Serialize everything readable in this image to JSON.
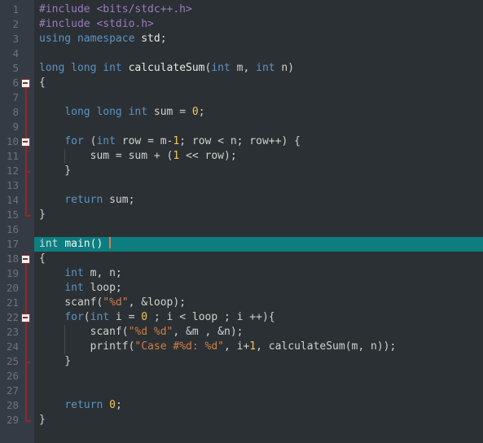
{
  "editor": {
    "language": "cpp",
    "total_lines": 29,
    "current_line": 17,
    "caret_line": 17,
    "colors": {
      "background": "#2b3034",
      "gutter_background": "#353b45",
      "line_number": "#697481",
      "current_line_highlight": "#0d7d80",
      "fold_marker": "#8e2a2a",
      "caret": "#d97d3f",
      "keyword": "#5d93c4",
      "preprocessor": "#9b7bc0",
      "string": "#ce7f47",
      "number": "#f2c75c",
      "identifier": "#cfd2cd",
      "function": "#e6e8e3",
      "indent_guide": "#4b525b"
    },
    "line_numbers": [
      1,
      2,
      3,
      4,
      5,
      6,
      7,
      8,
      9,
      10,
      11,
      12,
      13,
      14,
      15,
      16,
      17,
      18,
      19,
      20,
      21,
      22,
      23,
      24,
      25,
      26,
      27,
      28,
      29
    ],
    "fold_markers": [
      {
        "line": 6,
        "state": "expanded",
        "icon": "fold-minus-icon"
      },
      {
        "line": 10,
        "state": "expanded",
        "icon": "fold-minus-icon"
      },
      {
        "line": 18,
        "state": "expanded",
        "icon": "fold-minus-icon"
      },
      {
        "line": 22,
        "state": "expanded",
        "icon": "fold-minus-icon"
      }
    ],
    "lines": [
      {
        "n": 1,
        "tokens": [
          {
            "t": "#include <bits/stdc++.h>",
            "c": "pre"
          }
        ]
      },
      {
        "n": 2,
        "tokens": [
          {
            "t": "#include <stdio.h>",
            "c": "pre"
          }
        ]
      },
      {
        "n": 3,
        "tokens": [
          {
            "t": "using namespace",
            "c": "kw"
          },
          {
            "t": " ",
            "c": "plain"
          },
          {
            "t": "std",
            "c": "fn"
          },
          {
            "t": ";",
            "c": "id"
          }
        ]
      },
      {
        "n": 4,
        "tokens": []
      },
      {
        "n": 5,
        "tokens": [
          {
            "t": "long long int",
            "c": "kw"
          },
          {
            "t": " ",
            "c": "plain"
          },
          {
            "t": "calculateSum",
            "c": "fn"
          },
          {
            "t": "(",
            "c": "id"
          },
          {
            "t": "int",
            "c": "kw"
          },
          {
            "t": " m, ",
            "c": "id"
          },
          {
            "t": "int",
            "c": "kw"
          },
          {
            "t": " n)",
            "c": "id"
          }
        ]
      },
      {
        "n": 6,
        "tokens": [
          {
            "t": "{",
            "c": "id"
          }
        ]
      },
      {
        "n": 7,
        "tokens": []
      },
      {
        "n": 8,
        "tokens": [
          {
            "t": "    ",
            "c": "plain"
          },
          {
            "t": "long long int",
            "c": "kw"
          },
          {
            "t": " sum = ",
            "c": "id"
          },
          {
            "t": "0",
            "c": "num"
          },
          {
            "t": ";",
            "c": "id"
          }
        ]
      },
      {
        "n": 9,
        "tokens": []
      },
      {
        "n": 10,
        "tokens": [
          {
            "t": "    ",
            "c": "plain"
          },
          {
            "t": "for",
            "c": "kw"
          },
          {
            "t": " (",
            "c": "id"
          },
          {
            "t": "int",
            "c": "kw"
          },
          {
            "t": " row = m-",
            "c": "id"
          },
          {
            "t": "1",
            "c": "num"
          },
          {
            "t": "; row < n; row++) {",
            "c": "id"
          }
        ]
      },
      {
        "n": 11,
        "tokens": [
          {
            "t": "        sum = sum + (",
            "c": "id"
          },
          {
            "t": "1",
            "c": "num"
          },
          {
            "t": " << row);",
            "c": "id"
          }
        ]
      },
      {
        "n": 12,
        "tokens": [
          {
            "t": "    }",
            "c": "id"
          }
        ]
      },
      {
        "n": 13,
        "tokens": []
      },
      {
        "n": 14,
        "tokens": [
          {
            "t": "    ",
            "c": "plain"
          },
          {
            "t": "return",
            "c": "kw"
          },
          {
            "t": " sum;",
            "c": "id"
          }
        ]
      },
      {
        "n": 15,
        "tokens": [
          {
            "t": "}",
            "c": "id"
          }
        ]
      },
      {
        "n": 16,
        "tokens": []
      },
      {
        "n": 17,
        "tokens": [
          {
            "t": "int",
            "c": "kw"
          },
          {
            "t": " ",
            "c": "plain"
          },
          {
            "t": "main",
            "c": "fn"
          },
          {
            "t": "() ",
            "c": "id"
          }
        ],
        "caret_after": true
      },
      {
        "n": 18,
        "tokens": [
          {
            "t": "{",
            "c": "id"
          }
        ]
      },
      {
        "n": 19,
        "tokens": [
          {
            "t": "    ",
            "c": "plain"
          },
          {
            "t": "int",
            "c": "kw"
          },
          {
            "t": " m, n;",
            "c": "id"
          }
        ]
      },
      {
        "n": 20,
        "tokens": [
          {
            "t": "    ",
            "c": "plain"
          },
          {
            "t": "int",
            "c": "kw"
          },
          {
            "t": " loop;",
            "c": "id"
          }
        ]
      },
      {
        "n": 21,
        "tokens": [
          {
            "t": "    scanf(",
            "c": "id"
          },
          {
            "t": "\"%d\"",
            "c": "str"
          },
          {
            "t": ", &loop);",
            "c": "id"
          }
        ]
      },
      {
        "n": 22,
        "tokens": [
          {
            "t": "    ",
            "c": "plain"
          },
          {
            "t": "for",
            "c": "kw"
          },
          {
            "t": "(",
            "c": "id"
          },
          {
            "t": "int",
            "c": "kw"
          },
          {
            "t": " i = ",
            "c": "id"
          },
          {
            "t": "0",
            "c": "num"
          },
          {
            "t": " ; i < loop ; i ++){",
            "c": "id"
          }
        ]
      },
      {
        "n": 23,
        "tokens": [
          {
            "t": "        scanf(",
            "c": "id"
          },
          {
            "t": "\"%d %d\"",
            "c": "str"
          },
          {
            "t": ", &m , &n);",
            "c": "id"
          }
        ]
      },
      {
        "n": 24,
        "tokens": [
          {
            "t": "        printf(",
            "c": "id"
          },
          {
            "t": "\"Case #%d: %d\"",
            "c": "str"
          },
          {
            "t": ", i+",
            "c": "id"
          },
          {
            "t": "1",
            "c": "num"
          },
          {
            "t": ", calculateSum(m, n));",
            "c": "id"
          }
        ]
      },
      {
        "n": 25,
        "tokens": [
          {
            "t": "    }",
            "c": "id"
          }
        ]
      },
      {
        "n": 26,
        "tokens": []
      },
      {
        "n": 27,
        "tokens": []
      },
      {
        "n": 28,
        "tokens": [
          {
            "t": "    ",
            "c": "plain"
          },
          {
            "t": "return",
            "c": "kw"
          },
          {
            "t": " ",
            "c": "plain"
          },
          {
            "t": "0",
            "c": "num"
          },
          {
            "t": ";",
            "c": "id"
          }
        ]
      },
      {
        "n": 29,
        "tokens": [
          {
            "t": "}",
            "c": "id"
          }
        ]
      }
    ],
    "indent_guides": [
      {
        "line": 11,
        "col": 1
      },
      {
        "line": 23,
        "col": 1
      },
      {
        "line": 24,
        "col": 1
      }
    ],
    "fold_regions": [
      {
        "start": 6,
        "end": 15,
        "tick_lines": [
          12
        ]
      },
      {
        "start": 18,
        "end": 29,
        "tick_lines": [
          25
        ]
      }
    ]
  }
}
